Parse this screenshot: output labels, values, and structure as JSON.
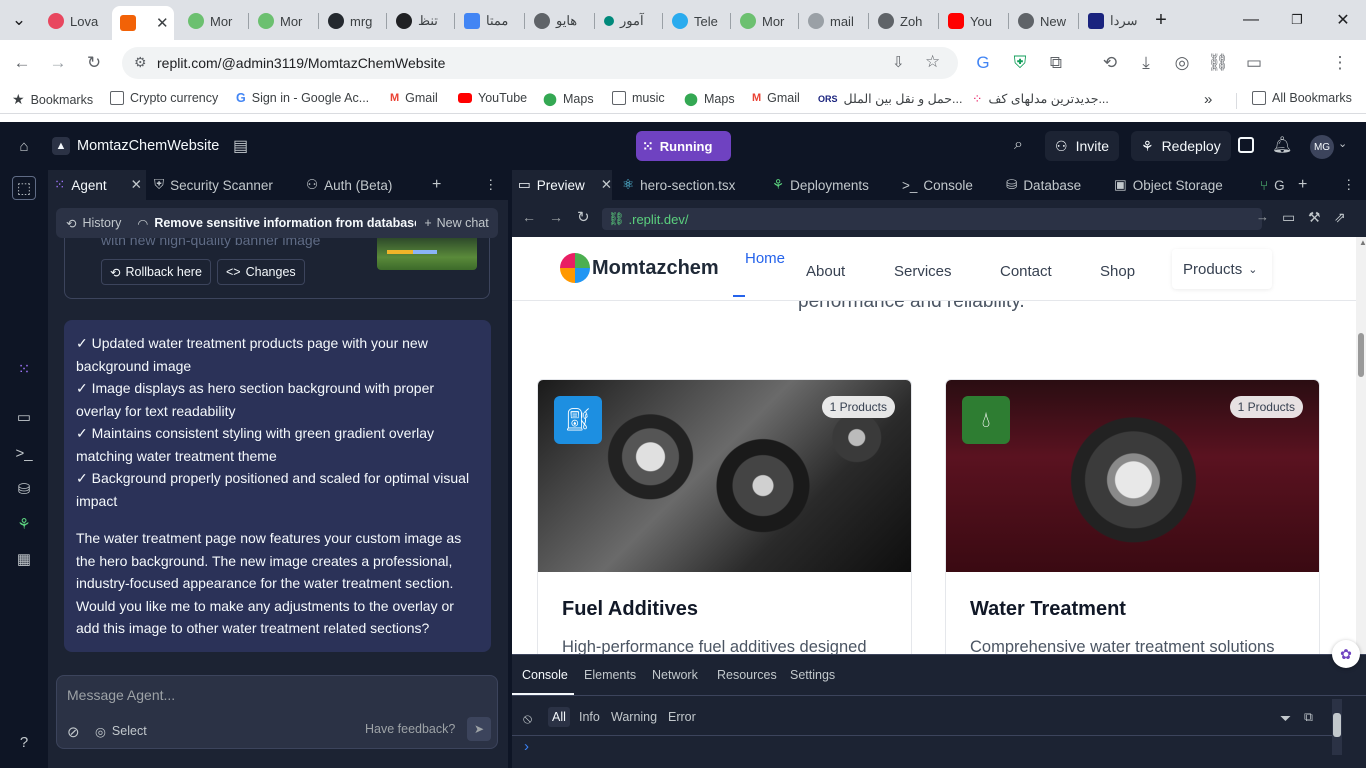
{
  "browser": {
    "tabs": [
      {
        "label": "Lova",
        "color": "#e8475f"
      },
      {
        "label": "",
        "color": "#f26207"
      },
      {
        "label": "Mor",
        "color": "#6cc070"
      },
      {
        "label": "Mor",
        "color": "#6cc070"
      },
      {
        "label": "mrg",
        "color": "#24292f"
      },
      {
        "label": "تنظ",
        "color": "#202124"
      },
      {
        "label": "ممتا",
        "color": "#4285f4"
      },
      {
        "label": "هايو",
        "color": "#5f6368"
      },
      {
        "label": "آمور",
        "color": "#00897b"
      },
      {
        "label": "Tele",
        "color": "#2aabee"
      },
      {
        "label": "Mor",
        "color": "#6cc070"
      },
      {
        "label": "mail",
        "color": "#9aa0a6"
      },
      {
        "label": "Zoh",
        "color": "#5f6368"
      },
      {
        "label": "You",
        "color": "#ff0000"
      },
      {
        "label": "New",
        "color": "#5f6368"
      },
      {
        "label": "سردا",
        "color": "#1a237e"
      }
    ],
    "url": "replit.com/@admin3119/MomtazChemWebsite",
    "bookmarks": [
      {
        "label": "Bookmarks"
      },
      {
        "label": "Crypto currency"
      },
      {
        "label": "Sign in - Google Ac..."
      },
      {
        "label": "Gmail"
      },
      {
        "label": "YouTube"
      },
      {
        "label": "Maps"
      },
      {
        "label": "music"
      },
      {
        "label": "Maps"
      },
      {
        "label": "Gmail"
      },
      {
        "label": "حمل و نقل بین الملل..."
      },
      {
        "label": "جدیدترین مدلهای کف..."
      },
      {
        "label": "All Bookmarks"
      }
    ]
  },
  "replit": {
    "project_name": "MomtazChemWebsite",
    "status": "Running",
    "invite": "Invite",
    "redeploy": "Redeploy",
    "avatar": "MG"
  },
  "agent": {
    "tabs": [
      "Agent",
      "Security Scanner",
      "Auth (Beta)"
    ],
    "history": "History",
    "chat_title": "Remove sensitive information from database ...",
    "new_chat": "New chat",
    "prev_text": "with new high-quality banner image",
    "rollback": "Rollback here",
    "changes": "Changes",
    "message_lines": [
      "✓ Updated water treatment products page with your new background image",
      "✓ Image displays as hero section background with proper overlay for text readability",
      "✓ Maintains consistent styling with green gradient overlay matching water treatment theme",
      "✓ Background properly positioned and scaled for optimal visual impact"
    ],
    "message_paragraph": "The water treatment page now features your custom image as the hero background. The new image creates a professional, industry-focused appearance for the water treatment section. Would you like me to make any adjustments to the overlay or add this image to other water treatment related sections?",
    "input_placeholder": "Message Agent...",
    "select": "Select",
    "feedback": "Have feedback?"
  },
  "workspace": {
    "tabs": [
      "Preview",
      "hero-section.tsx",
      "Deployments",
      "Console",
      "Database",
      "Object Storage",
      "G"
    ],
    "preview_url": ".replit.dev/"
  },
  "site": {
    "logo": "Momtazchem",
    "nav": [
      "Home",
      "About",
      "Services",
      "Contact",
      "Shop",
      "Products"
    ],
    "hero_tail": "performance and reliability.",
    "cards": [
      {
        "badge": "1 Products",
        "title": "Fuel Additives",
        "desc": "High-performance fuel additives designed",
        "icon_color": "#1d8fe1"
      },
      {
        "badge": "1 Products",
        "title": "Water Treatment",
        "desc": "Comprehensive water treatment solutions",
        "icon_color": "#2e7d32"
      }
    ]
  },
  "console": {
    "tabs": [
      "Console",
      "Elements",
      "Network",
      "Resources",
      "Settings"
    ],
    "filters": [
      "All",
      "Info",
      "Warning",
      "Error"
    ]
  }
}
